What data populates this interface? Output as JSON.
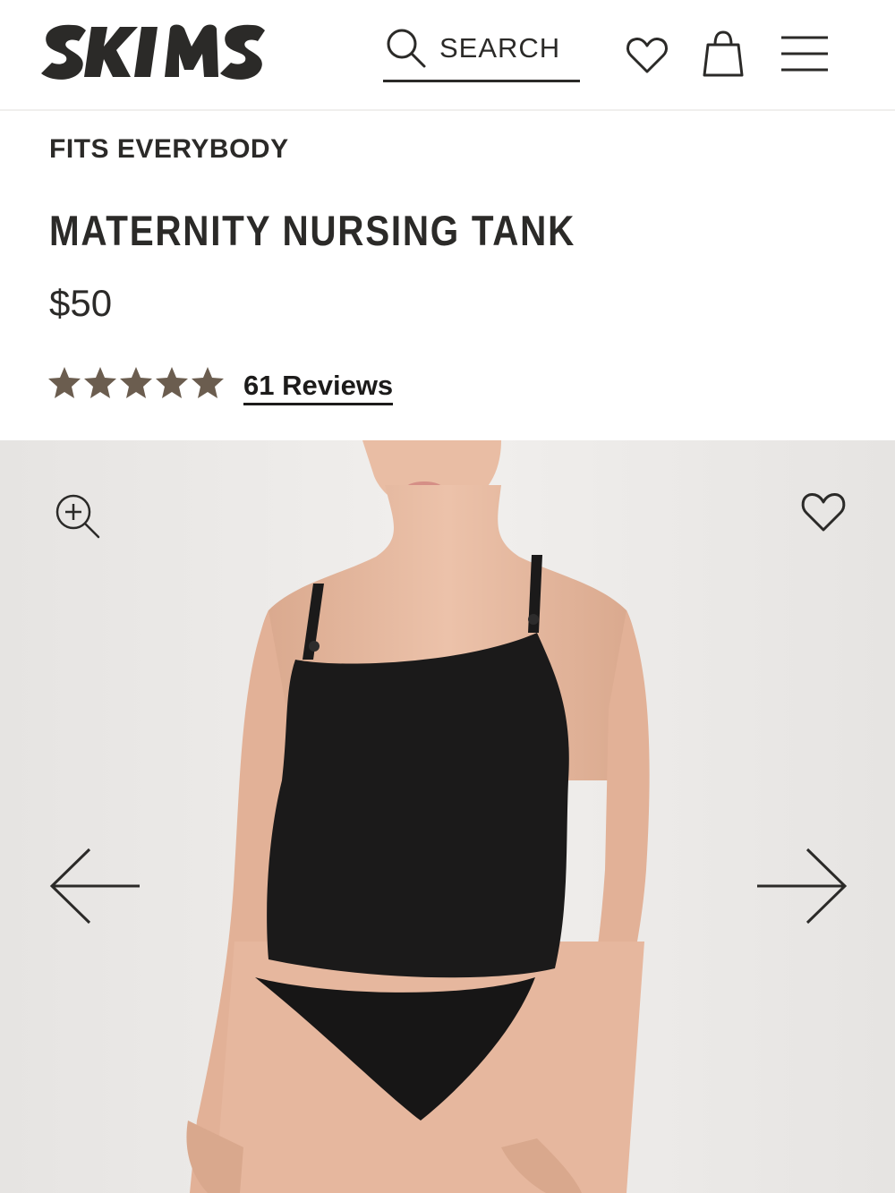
{
  "header": {
    "brand": "SKIMS",
    "search_label": "SEARCH",
    "icons": [
      "search-icon",
      "heart-icon",
      "shopping-bag-icon",
      "menu-icon"
    ]
  },
  "product": {
    "eyebrow": "FITS EVERYBODY",
    "title": "MATERNITY NURSING TANK",
    "price": "$50",
    "rating": 5,
    "rating_max": 5,
    "reviews_link": "61 Reviews"
  },
  "gallery": {
    "icons": [
      "zoom-in-icon",
      "heart-icon",
      "arrow-left-icon",
      "arrow-right-icon"
    ]
  },
  "colors": {
    "text": "#2b2a28",
    "star": "#6b5d4f",
    "gallery_bg": "#eceae8",
    "garment": "#1b1a1a",
    "skin": "#e6b79e"
  }
}
